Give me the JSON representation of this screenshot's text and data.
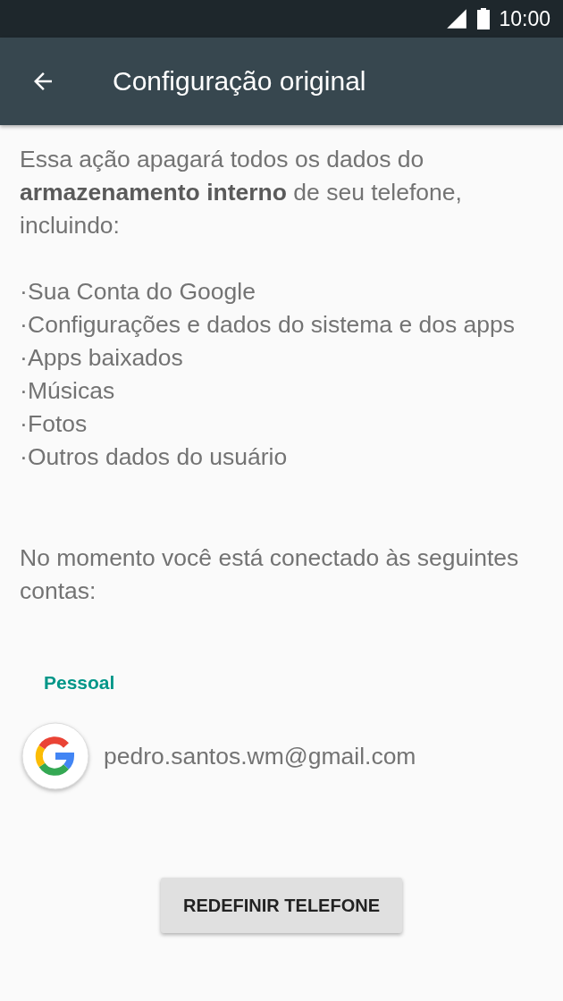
{
  "status_bar": {
    "time": "10:00"
  },
  "toolbar": {
    "title": "Configuração original"
  },
  "intro": "Essa ação apagará todos os dados do **armazenamento interno** de seu telefone, incluindo:",
  "items": [
    {
      "marker": "·",
      "text": "Sua Conta do Google"
    },
    {
      "marker": "·",
      "text": "Configurações e dados do sistema e dos apps"
    },
    {
      "marker": "·",
      "text": "Apps baixados"
    },
    {
      "marker": "·",
      "text": "Músicas"
    },
    {
      "marker": "·",
      "text": "Fotos"
    },
    {
      "marker": "·",
      "text": "Outros dados do usuário"
    }
  ],
  "accounts_note": "No momento você está conectado às seguintes contas:",
  "account_group": {
    "label": "Pessoal",
    "accounts": [
      {
        "email": "pedro.santos.wm@gmail.com"
      }
    ]
  },
  "button": "REDEFINIR TELEFONE"
}
